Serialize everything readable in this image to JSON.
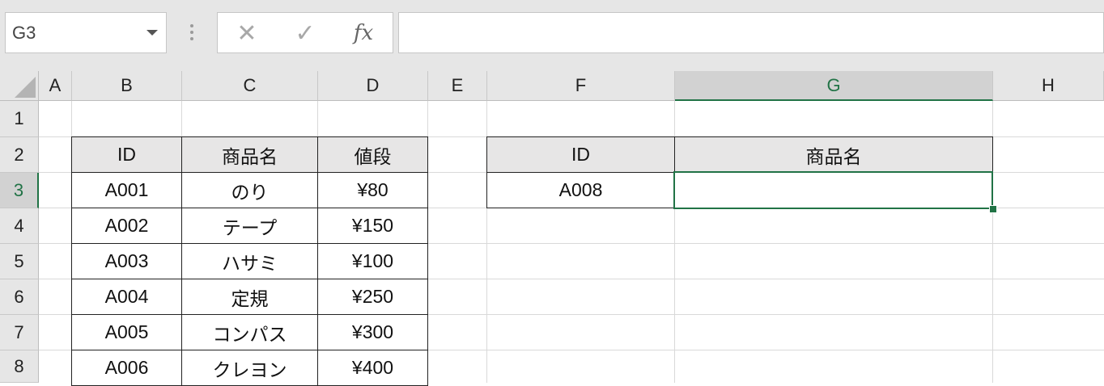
{
  "name_box": {
    "value": "G3"
  },
  "formula_bar": {
    "cancel_symbol": "✕",
    "enter_symbol": "✓",
    "function_symbol": "fx",
    "value": ""
  },
  "columns": [
    "A",
    "B",
    "C",
    "D",
    "E",
    "F",
    "G",
    "H"
  ],
  "rows": [
    "1",
    "2",
    "3",
    "4",
    "5",
    "6",
    "7",
    "8"
  ],
  "selected": {
    "column": "G",
    "row": "3"
  },
  "product_table": {
    "headers": [
      "ID",
      "商品名",
      "値段"
    ],
    "rows": [
      [
        "A001",
        "のり",
        "¥80"
      ],
      [
        "A002",
        "テープ",
        "¥150"
      ],
      [
        "A003",
        "ハサミ",
        "¥100"
      ],
      [
        "A004",
        "定規",
        "¥250"
      ],
      [
        "A005",
        "コンパス",
        "¥300"
      ],
      [
        "A006",
        "クレヨン",
        "¥400"
      ]
    ]
  },
  "lookup_table": {
    "headers": [
      "ID",
      "商品名"
    ],
    "row": [
      "A008",
      ""
    ]
  },
  "colors": {
    "selection": "#217346",
    "header_fill": "#e7e6e6"
  }
}
